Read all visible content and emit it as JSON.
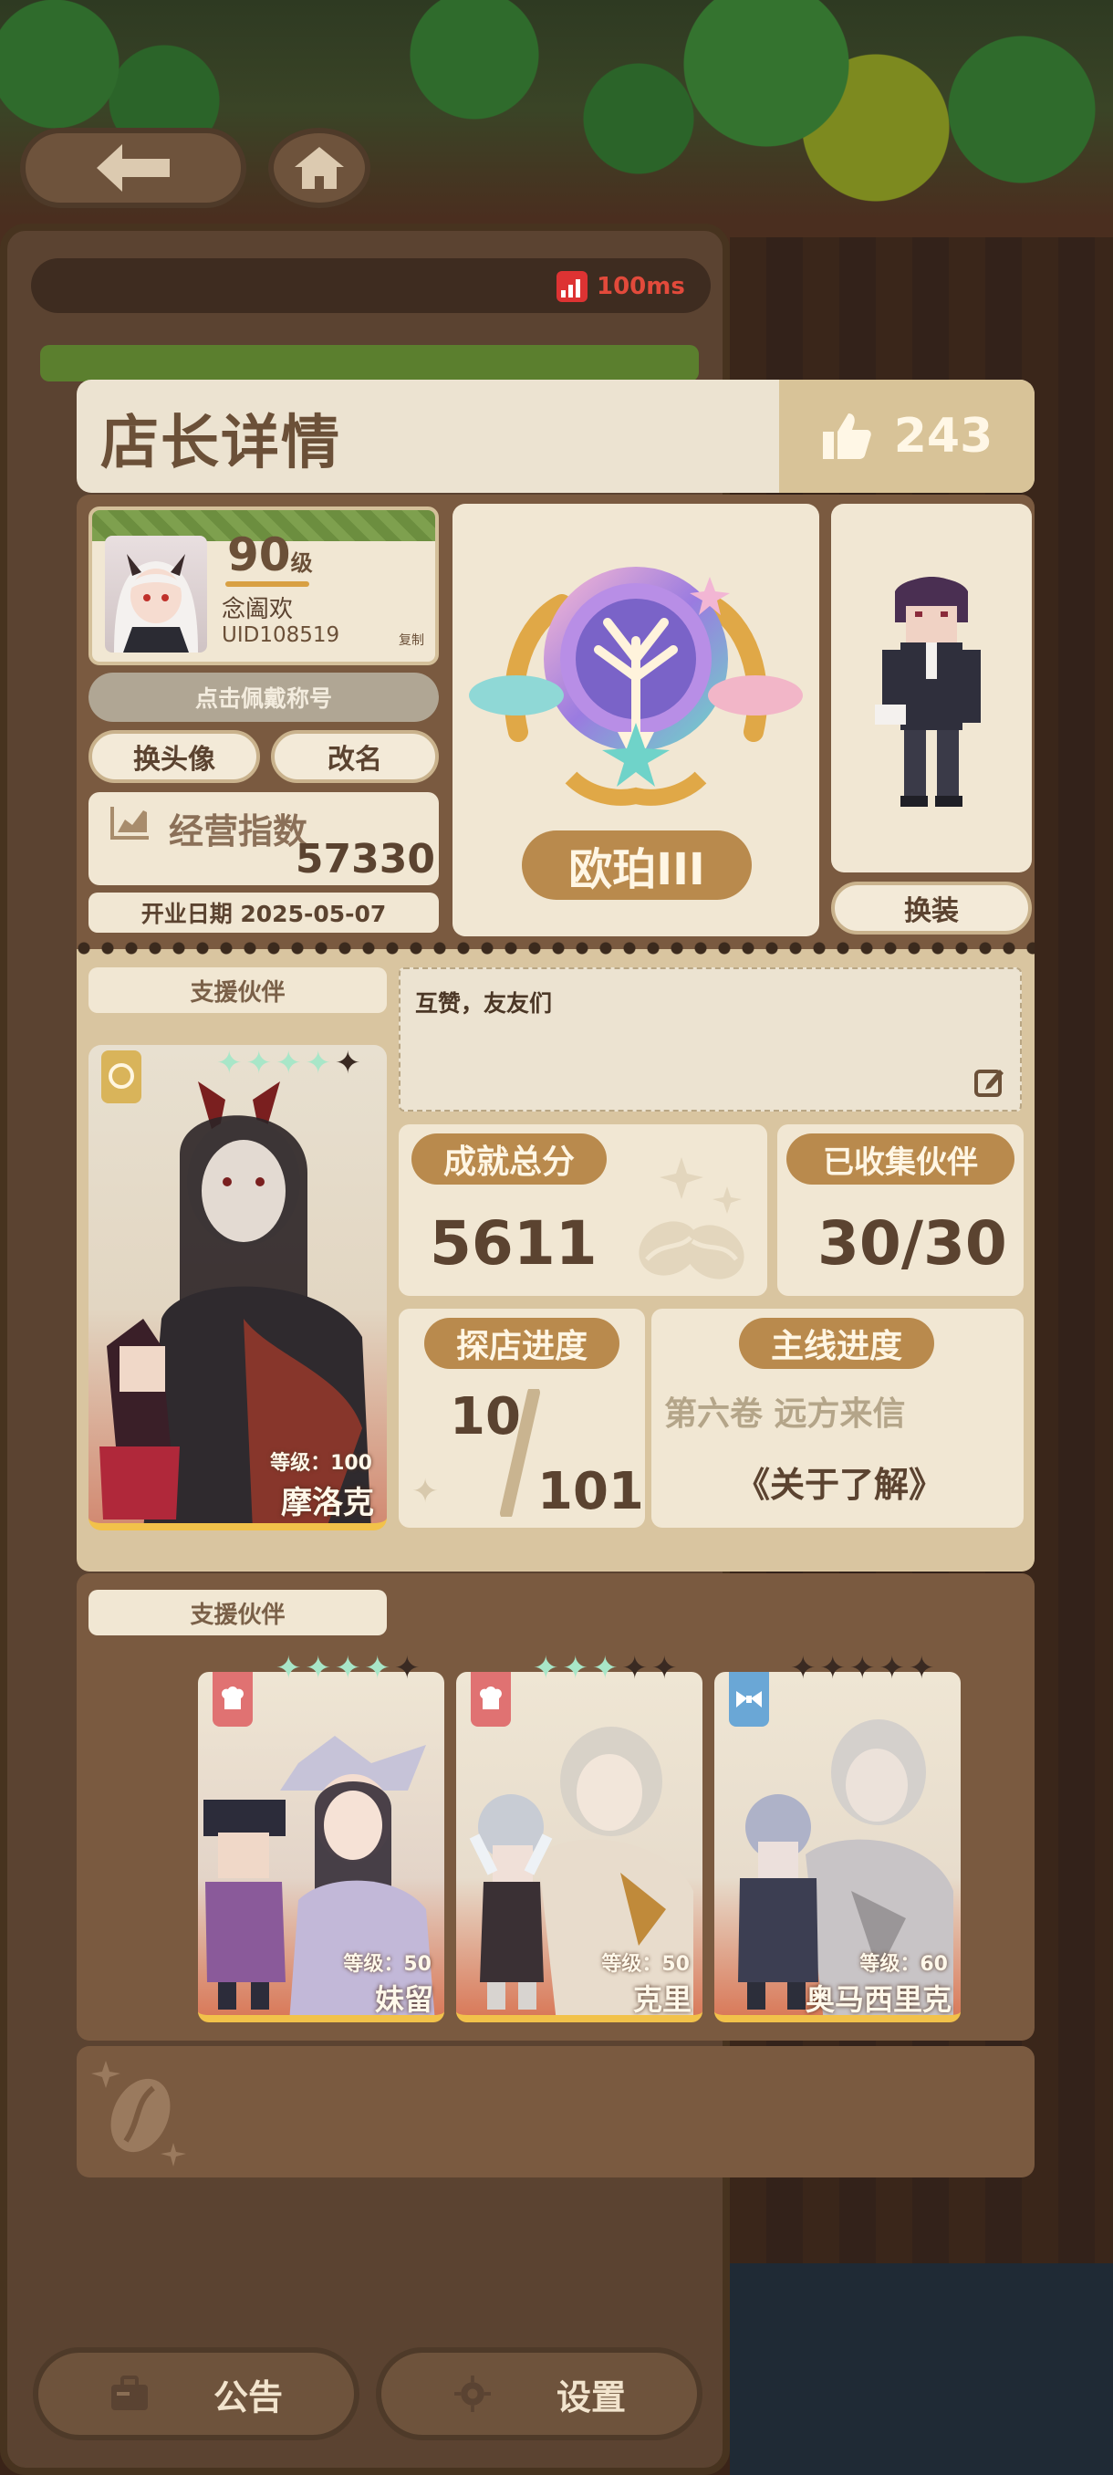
{
  "status": {
    "ping": "100ms"
  },
  "header": {
    "title": "店长详情",
    "likes": "243"
  },
  "profile": {
    "level": "90",
    "level_unit": "级",
    "nickname": "念阖欢",
    "uid": "UID108519",
    "copy_label": "复制",
    "title_hint": "点击佩戴称号",
    "change_avatar": "换头像",
    "rename": "改名",
    "business_index_label": "经营指数",
    "business_index_value": "57330",
    "open_date": "开业日期 2025-05-07"
  },
  "badge": {
    "name": "欧珀III"
  },
  "character": {
    "outfit_button": "换装"
  },
  "support_main": {
    "section_label": "支援伙伴",
    "partner_level": "等级：100",
    "partner_name": "摩洛克",
    "stars": 4
  },
  "message": {
    "text": "互赞，友友们"
  },
  "stats": {
    "achievement_label": "成就总分",
    "achievement_value": "5611",
    "collected_label": "已收集伙伴",
    "collected_value": "30/30",
    "explore_label": "探店进度",
    "explore_current": "10",
    "explore_total": "101",
    "main_label": "主线进度",
    "main_chapter": "第六卷 远方来信",
    "main_quest": "《关于了解》"
  },
  "support_list": {
    "section_label": "支援伙伴",
    "cards": [
      {
        "name": "妹留",
        "level": "等级：50",
        "stars": 4,
        "icon": "chef-hat-icon",
        "icon_color": "#e07272"
      },
      {
        "name": "克里",
        "level": "等级：50",
        "stars": 3,
        "icon": "chef-hat-icon",
        "icon_color": "#e07272"
      },
      {
        "name": "奥马西里克",
        "level": "等级：60",
        "stars": 0,
        "icon": "bow-tie-icon",
        "icon_color": "#6aa7d6"
      }
    ]
  },
  "bottom_nav": {
    "notice": "公告",
    "settings": "设置"
  },
  "colors": {
    "accent": "#b98a4d",
    "panel": "#f1e7d3",
    "frame": "#7a5a40"
  }
}
